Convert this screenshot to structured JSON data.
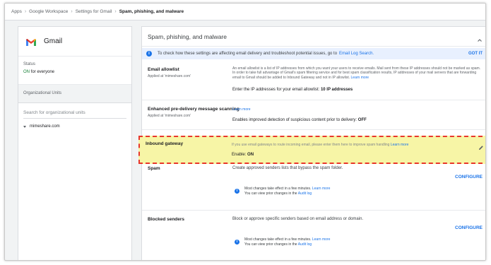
{
  "breadcrumb": {
    "items": [
      "Apps",
      "Google Workspace",
      "Settings for Gmail"
    ],
    "current": "Spam, phishing, and malware",
    "separator": "›"
  },
  "left": {
    "app_name": "Gmail",
    "status_label": "Status",
    "status_on": "ON",
    "status_rest": "for everyone",
    "ou_label": "Organizational Units",
    "search_placeholder": "Search for organizational units",
    "tree_item": "mimeshare.com"
  },
  "section": {
    "title": "Spam, phishing, and malware",
    "info_text": "To check how these settings are affecting email delivery and troubleshoot potential issues, go to",
    "info_link": "Email Log Search.",
    "got_it": "GOT IT"
  },
  "rows": {
    "allowlist": {
      "title": "Email allowlist",
      "sub": "Applied at 'mimeshare.com'",
      "desc": "An email allowlist is a list of IP addresses from which you want your users to receive emails. Mail sent from these IP addresses should not be marked as spam. In order to take full advantage of Gmail's spam filtering service and for best spam classification results, IP addresses of your mail servers that are forwarding email to Gmail should be added to Inbound Gateway and not in IP allowlist.",
      "desc_link": "Learn more",
      "value_label": "Enter the IP addresses for your email allowlist:",
      "value": "10 IP addresses"
    },
    "predelivery": {
      "title": "Enhanced pre-delivery message scanning",
      "sub": "Applied at 'mimeshare.com'",
      "link": "Learn more",
      "value_label": "Enables improved detection of suspicious content prior to delivery:",
      "value": "OFF"
    },
    "inbound": {
      "title": "Inbound gateway",
      "desc": "If you use email gateways to route incoming email, please enter them here to improve spam handling",
      "desc_link": "Learn more",
      "value_label": "Enable:",
      "value": "ON"
    },
    "spam": {
      "title": "Spam",
      "desc": "Create approved senders lists that bypass the spam folder.",
      "configure": "CONFIGURE",
      "note_line1": "Most changes take effect in a few minutes.",
      "note_link1": "Learn more",
      "note_line2": "You can view prior changes in the",
      "note_link2": "Audit log"
    },
    "blocked": {
      "title": "Blocked senders",
      "desc": "Block or approve specific senders based on email address or domain.",
      "configure": "CONFIGURE",
      "note_line1": "Most changes take effect in a few minutes.",
      "note_link1": "Learn more",
      "note_line2": "You can view prior changes in the",
      "note_link2": "Audit log"
    }
  },
  "icons": {
    "gmail": "gmail-logo",
    "info": "info-icon",
    "collapse": "chevron-up-icon",
    "edit": "pencil-icon",
    "tree": "triangle-down-icon"
  },
  "colors": {
    "accent": "#1a73e8",
    "on_green": "#188038",
    "highlight": "#f7f5a6",
    "highlight_border": "#e8362b"
  }
}
